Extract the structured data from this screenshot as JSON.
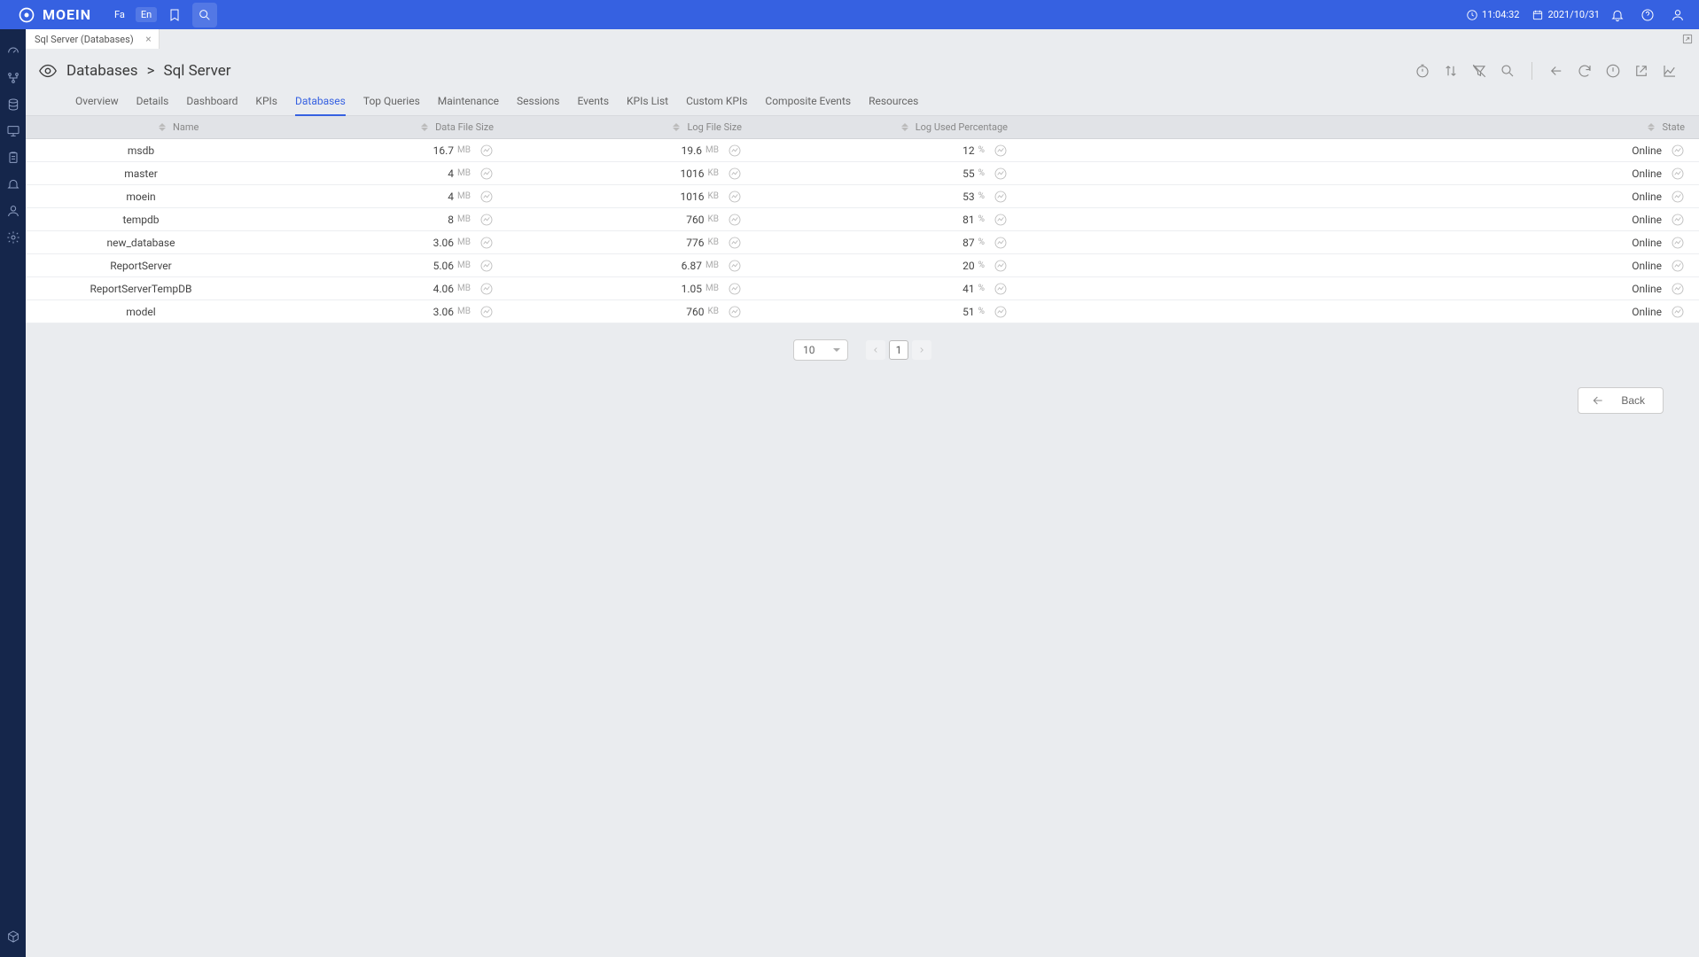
{
  "header": {
    "brand": "MOEIN",
    "lang_fa": "Fa",
    "lang_en": "En",
    "time": "11:04:32",
    "date": "2021/10/31"
  },
  "doc_tab": {
    "title": "Sql Server (Databases)"
  },
  "breadcrumbs": {
    "part1": "Databases",
    "sep": ">",
    "part2": "Sql Server"
  },
  "subtabs": [
    {
      "label": "Overview",
      "active": false
    },
    {
      "label": "Details",
      "active": false
    },
    {
      "label": "Dashboard",
      "active": false
    },
    {
      "label": "KPIs",
      "active": false
    },
    {
      "label": "Databases",
      "active": true
    },
    {
      "label": "Top Queries",
      "active": false
    },
    {
      "label": "Maintenance",
      "active": false
    },
    {
      "label": "Sessions",
      "active": false
    },
    {
      "label": "Events",
      "active": false
    },
    {
      "label": "KPIs List",
      "active": false
    },
    {
      "label": "Custom KPIs",
      "active": false
    },
    {
      "label": "Composite Events",
      "active": false
    },
    {
      "label": "Resources",
      "active": false
    }
  ],
  "columns": {
    "name": "Name",
    "data_file_size": "Data File Size",
    "log_file_size": "Log File Size",
    "log_used_pct": "Log Used Percentage",
    "state": "State"
  },
  "rows": [
    {
      "name": "msdb",
      "data_val": "16.7",
      "data_unit": "MB",
      "log_val": "19.6",
      "log_unit": "MB",
      "pct_val": "12",
      "pct_unit": "%",
      "state": "Online"
    },
    {
      "name": "master",
      "data_val": "4",
      "data_unit": "MB",
      "log_val": "1016",
      "log_unit": "KB",
      "pct_val": "55",
      "pct_unit": "%",
      "state": "Online"
    },
    {
      "name": "moein",
      "data_val": "4",
      "data_unit": "MB",
      "log_val": "1016",
      "log_unit": "KB",
      "pct_val": "53",
      "pct_unit": "%",
      "state": "Online"
    },
    {
      "name": "tempdb",
      "data_val": "8",
      "data_unit": "MB",
      "log_val": "760",
      "log_unit": "KB",
      "pct_val": "81",
      "pct_unit": "%",
      "state": "Online"
    },
    {
      "name": "new_database",
      "data_val": "3.06",
      "data_unit": "MB",
      "log_val": "776",
      "log_unit": "KB",
      "pct_val": "87",
      "pct_unit": "%",
      "state": "Online"
    },
    {
      "name": "ReportServer",
      "data_val": "5.06",
      "data_unit": "MB",
      "log_val": "6.87",
      "log_unit": "MB",
      "pct_val": "20",
      "pct_unit": "%",
      "state": "Online"
    },
    {
      "name": "ReportServerTempDB",
      "data_val": "4.06",
      "data_unit": "MB",
      "log_val": "1.05",
      "log_unit": "MB",
      "pct_val": "41",
      "pct_unit": "%",
      "state": "Online"
    },
    {
      "name": "model",
      "data_val": "3.06",
      "data_unit": "MB",
      "log_val": "760",
      "log_unit": "KB",
      "pct_val": "51",
      "pct_unit": "%",
      "state": "Online"
    }
  ],
  "pagination": {
    "page_size": "10",
    "current_page": "1"
  },
  "back_button": "Back"
}
